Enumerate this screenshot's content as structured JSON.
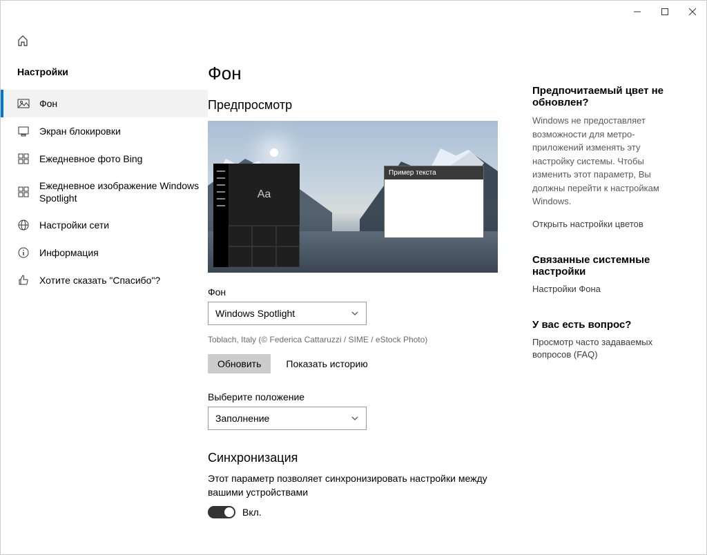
{
  "titlebar": {},
  "sidebar": {
    "settings_label": "Настройки",
    "items": [
      {
        "label": "Фон"
      },
      {
        "label": "Экран блокировки"
      },
      {
        "label": "Ежедневное фото Bing"
      },
      {
        "label": "Ежедневное изображение Windows Spotlight"
      },
      {
        "label": "Настройки сети"
      },
      {
        "label": "Информация"
      },
      {
        "label": "Хотите сказать \"Спасибо\"?"
      }
    ]
  },
  "main": {
    "title": "Фон",
    "preview_heading": "Предпросмотр",
    "preview_sample_text": "Пример текста",
    "preview_aa": "Aa",
    "background_label": "Фон",
    "background_value": "Windows Spotlight",
    "credit": "Toblach, Italy (© Federica Cattaruzzi / SIME / eStock Photo)",
    "refresh_btn": "Обновить",
    "history_btn": "Показать историю",
    "position_label": "Выберите положение",
    "position_value": "Заполнение",
    "sync_heading": "Синхронизация",
    "sync_desc": "Этот параметр позволяет синхронизировать настройки между вашими устройствами",
    "sync_toggle_label": "Вкл."
  },
  "right": {
    "block1_heading": "Предпочитаемый цвет не обновлен?",
    "block1_text": "Windows не предоставляет возможности для метро-приложений изменять эту настройку системы. Чтобы изменить этот параметр, Вы должны перейти к настройкам Windows.",
    "block1_link": "Открыть настройки цветов",
    "block2_heading": "Связанные системные настройки",
    "block2_link": "Настройки Фона",
    "block3_heading": "У вас есть вопрос?",
    "block3_link": "Просмотр часто задаваемых вопросов (FAQ)"
  }
}
